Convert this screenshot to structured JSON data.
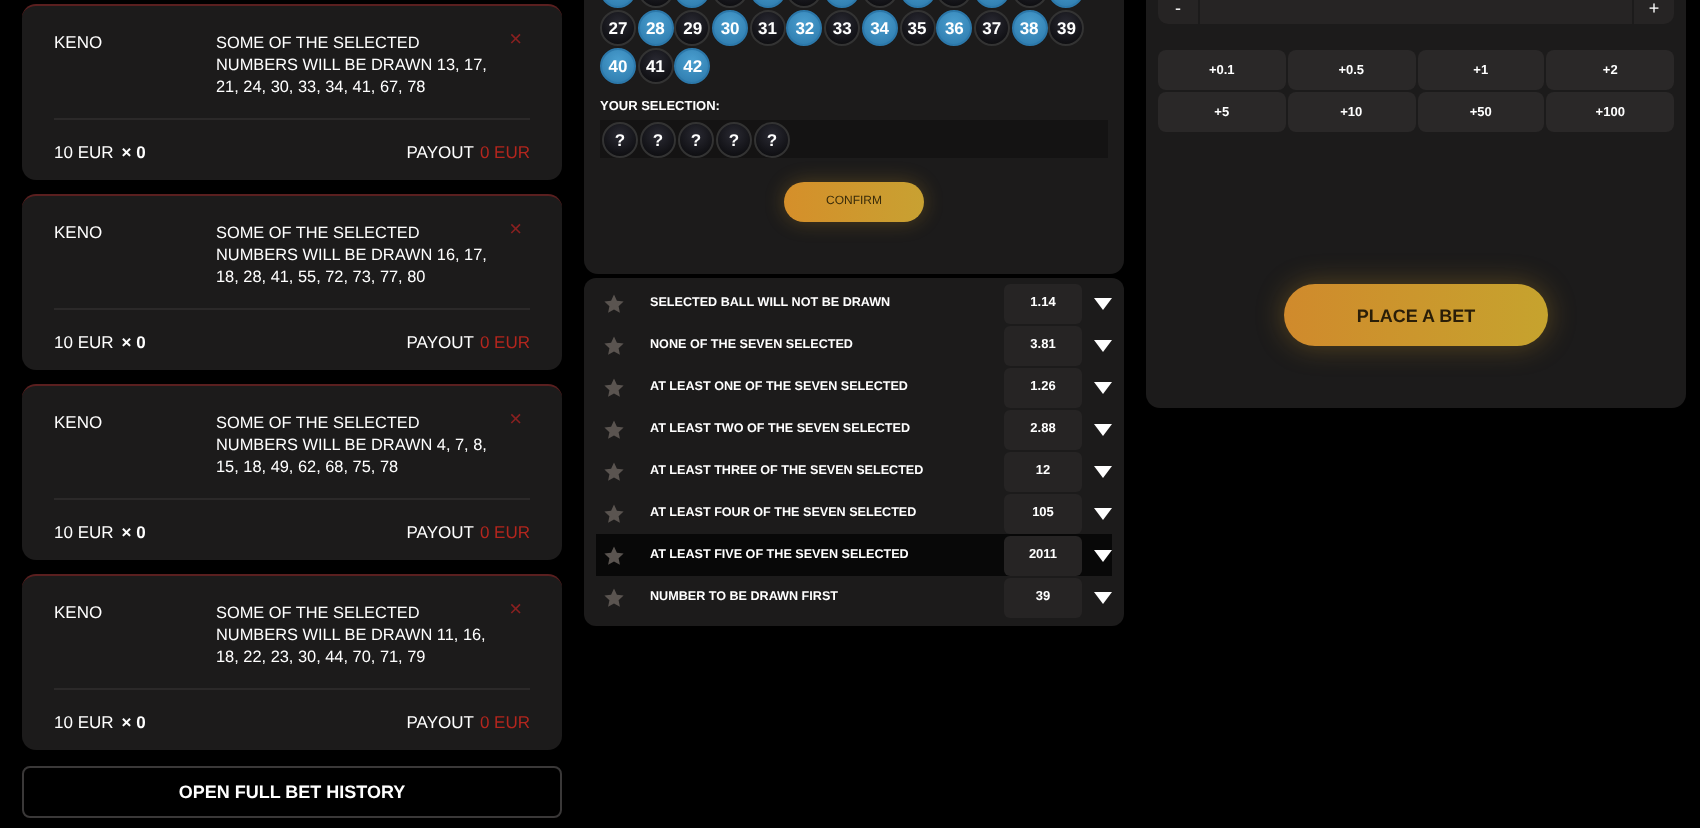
{
  "bet_history": [
    {
      "game": "KENO",
      "description": "SOME OF THE SELECTED NUMBERS WILL BE DRAWN 13, 17, 21, 24, 30, 33, 34, 41, 67, 78",
      "close": "×",
      "stake": "10 EUR",
      "multiplier": "× 0",
      "payout_label": "PAYOUT",
      "payout": "0 EUR"
    },
    {
      "game": "KENO",
      "description": "SOME OF THE SELECTED NUMBERS WILL BE DRAWN 16, 17, 18, 28, 41, 55, 72, 73, 77, 80",
      "close": "×",
      "stake": "10 EUR",
      "multiplier": "× 0",
      "payout_label": "PAYOUT",
      "payout": "0 EUR"
    },
    {
      "game": "KENO",
      "description": "SOME OF THE SELECTED NUMBERS WILL BE DRAWN 4, 7, 8, 15, 18, 49, 62, 68, 75, 78",
      "close": "×",
      "stake": "10 EUR",
      "multiplier": "× 0",
      "payout_label": "PAYOUT",
      "payout": "0 EUR"
    },
    {
      "game": "KENO",
      "description": "SOME OF THE SELECTED NUMBERS WILL BE DRAWN 11, 16, 18, 22, 23, 30, 44, 70, 71, 79",
      "close": "×",
      "stake": "10 EUR",
      "multiplier": "× 0",
      "payout_label": "PAYOUT",
      "payout": "0 EUR"
    }
  ],
  "history_button": "OPEN FULL BET HISTORY",
  "board": {
    "cut_row": [
      {
        "selected": true
      },
      {
        "selected": false
      },
      {
        "selected": true
      },
      {
        "selected": false
      },
      {
        "selected": true
      },
      {
        "selected": false
      },
      {
        "selected": true
      },
      {
        "selected": false
      },
      {
        "selected": true
      },
      {
        "selected": false
      },
      {
        "selected": true
      },
      {
        "selected": false
      },
      {
        "selected": true
      }
    ],
    "balls": [
      {
        "number": "27",
        "selected": false
      },
      {
        "number": "28",
        "selected": true
      },
      {
        "number": "29",
        "selected": false
      },
      {
        "number": "30",
        "selected": true
      },
      {
        "number": "31",
        "selected": false
      },
      {
        "number": "32",
        "selected": true
      },
      {
        "number": "33",
        "selected": false
      },
      {
        "number": "34",
        "selected": true
      },
      {
        "number": "35",
        "selected": false
      },
      {
        "number": "36",
        "selected": true
      },
      {
        "number": "37",
        "selected": false
      },
      {
        "number": "38",
        "selected": true
      },
      {
        "number": "39",
        "selected": false
      },
      {
        "number": "40",
        "selected": true
      },
      {
        "number": "41",
        "selected": false
      },
      {
        "number": "42",
        "selected": true
      }
    ],
    "selection_label": "YOUR SELECTION:",
    "slots": [
      "?",
      "?",
      "?",
      "?",
      "?"
    ],
    "confirm": "CONFIRM"
  },
  "markets": [
    {
      "name": "SELECTED BALL WILL NOT BE DRAWN",
      "odds": "1.14",
      "favorite": false,
      "selected": false
    },
    {
      "name": "NONE OF THE SEVEN SELECTED",
      "odds": "3.81",
      "favorite": false,
      "selected": false
    },
    {
      "name": "AT LEAST ONE OF THE SEVEN SELECTED",
      "odds": "1.26",
      "favorite": false,
      "selected": false
    },
    {
      "name": "AT LEAST TWO OF THE SEVEN SELECTED",
      "odds": "2.88",
      "favorite": false,
      "selected": false
    },
    {
      "name": "AT LEAST THREE OF THE SEVEN SELECTED",
      "odds": "12",
      "favorite": false,
      "selected": false
    },
    {
      "name": "AT LEAST FOUR OF THE SEVEN SELECTED",
      "odds": "105",
      "favorite": false,
      "selected": false
    },
    {
      "name": "AT LEAST FIVE OF THE SEVEN SELECTED",
      "odds": "2011",
      "favorite": false,
      "selected": true
    },
    {
      "name": "NUMBER TO BE DRAWN FIRST",
      "odds": "39",
      "favorite": false,
      "selected": false
    }
  ],
  "stake": {
    "minus": "-",
    "plus": "+"
  },
  "quick_amounts": [
    "+0.1",
    "+0.5",
    "+1",
    "+2",
    "+5",
    "+10",
    "+50",
    "+100"
  ],
  "place_bet": "PLACE A BET"
}
